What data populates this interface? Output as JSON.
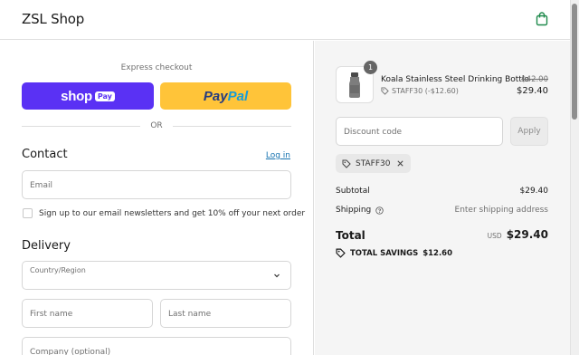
{
  "header": {
    "brand": "ZSL Shop",
    "cart_icon": "shopping-bag-icon",
    "accent_color": "#1f8a4c"
  },
  "express": {
    "label": "Express checkout",
    "shop_pay": {
      "word": "shop",
      "badge": "Pay",
      "color": "#5a31f4"
    },
    "paypal": {
      "part1": "Pay",
      "part2": "Pal",
      "color": "#ffc439"
    },
    "divider": "OR"
  },
  "contact": {
    "heading": "Contact",
    "login_link": "Log in",
    "email_placeholder": "Email",
    "newsletter_label": "Sign up to our email newsletters and get 10% off your next order",
    "newsletter_checked": false
  },
  "delivery": {
    "heading": "Delivery",
    "country_label": "Country/Region",
    "first_name_placeholder": "First name",
    "last_name_placeholder": "Last name",
    "company_placeholder": "Company (optional)"
  },
  "summary": {
    "item": {
      "quantity": "1",
      "name": "Koala Stainless Steel Drinking Bottle",
      "discount_tag": "STAFF30 (-$12.60)",
      "price_original": "$42.00",
      "price_final": "$29.40"
    },
    "discount_placeholder": "Discount code",
    "apply_label": "Apply",
    "applied_code": "STAFF30",
    "subtotal_label": "Subtotal",
    "subtotal_value": "$29.40",
    "shipping_label": "Shipping",
    "shipping_value": "Enter shipping address",
    "total_label": "Total",
    "currency": "USD",
    "total_value": "$29.40",
    "savings_label": "TOTAL SAVINGS",
    "savings_value": "$12.60"
  }
}
